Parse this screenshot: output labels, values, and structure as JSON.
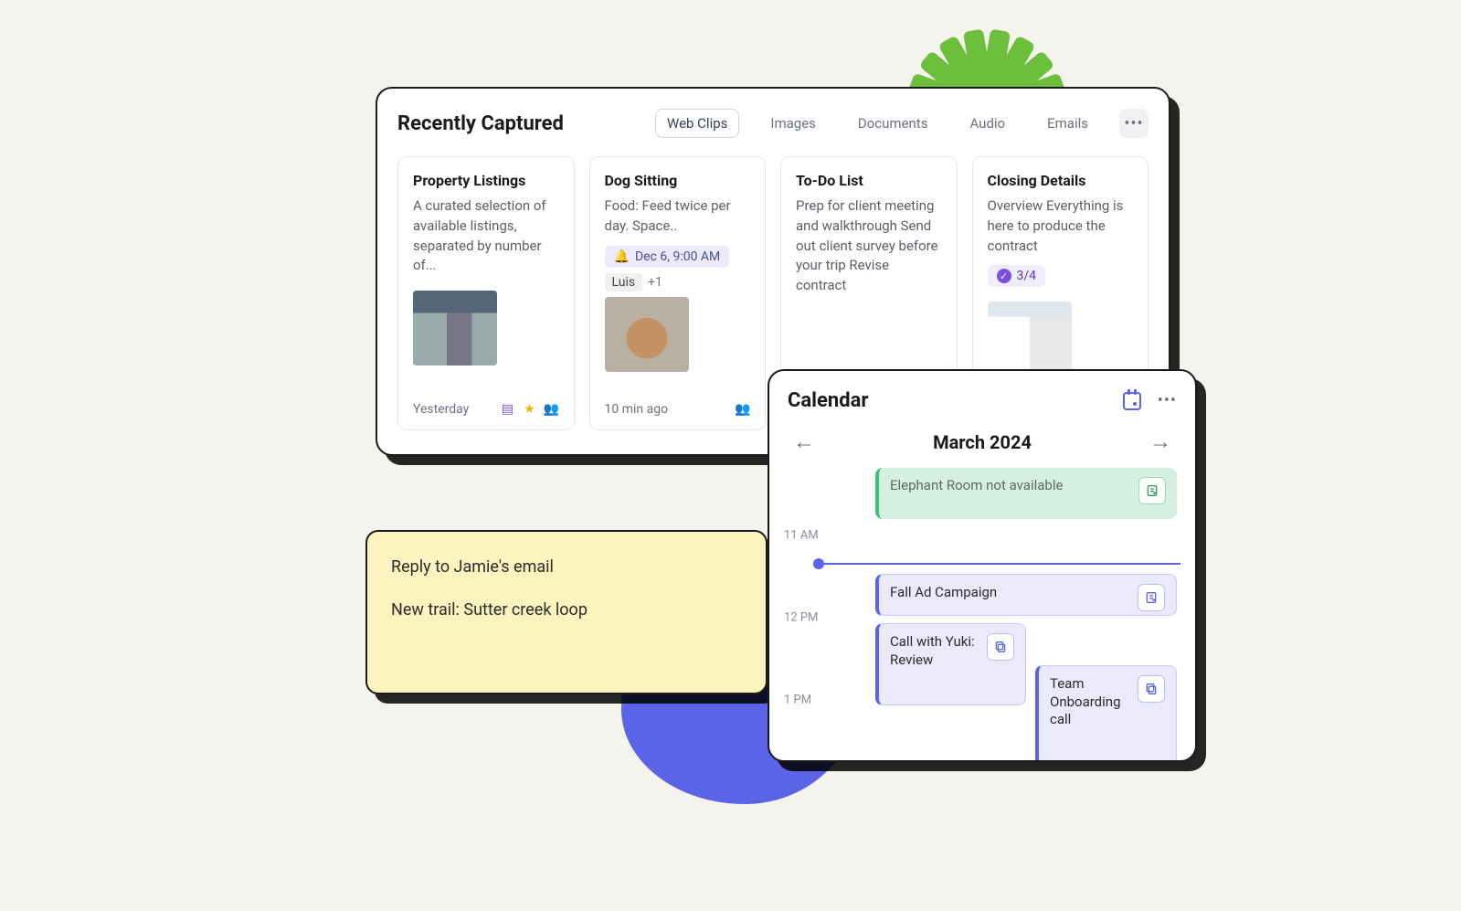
{
  "captured": {
    "title": "Recently Captured",
    "tabs": {
      "webclips": "Web Clips",
      "images": "Images",
      "documents": "Documents",
      "audio": "Audio",
      "emails": "Emails"
    },
    "cards": [
      {
        "title": "Property Listings",
        "body": "A curated selection of available listings, separated by number of...",
        "footer_time": "Yesterday"
      },
      {
        "title": "Dog Sitting",
        "body": "Food: Feed twice per day. Space..",
        "reminder": "Dec 6, 9:00 AM",
        "person": "Luis",
        "plus": "+1",
        "footer_time": "10 min ago"
      },
      {
        "title": "To-Do List",
        "body": "Prep for client meeting and walkthrough Send out client survey before your trip Revise contract"
      },
      {
        "title": "Closing Details",
        "body": "Overview Everything is here to produce the contract",
        "progress": "3/4"
      }
    ]
  },
  "sticky": {
    "line1": "Reply to Jamie's email",
    "line2": "New trail: Sutter creek loop"
  },
  "calendar": {
    "title": "Calendar",
    "month": "March 2024",
    "times": {
      "t11": "11 AM",
      "t12": "12 PM",
      "t1": "1 PM"
    },
    "events": {
      "elephant": "Elephant Room not available",
      "fall": "Fall Ad Campaign",
      "yuki": "Call with Yuki: Review",
      "team": "Team Onboarding call"
    }
  }
}
